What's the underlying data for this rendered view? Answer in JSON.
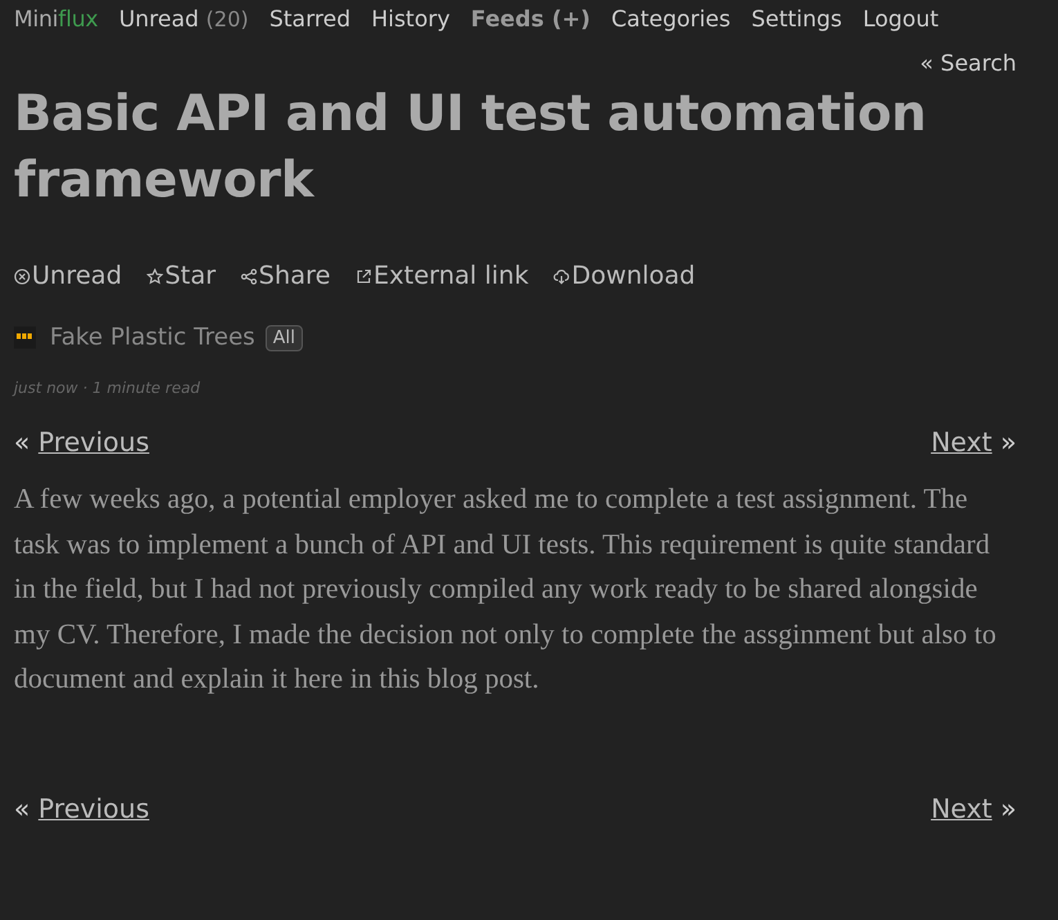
{
  "logo": {
    "prefix": "Mini",
    "suffix": "flux"
  },
  "nav": [
    {
      "label": "Unread",
      "count": "(20)",
      "selected": false
    },
    {
      "label": "Starred",
      "selected": false
    },
    {
      "label": "History",
      "selected": false
    },
    {
      "label": "Feeds (+)",
      "selected": true
    },
    {
      "label": "Categories",
      "selected": false
    },
    {
      "label": "Settings",
      "selected": false
    },
    {
      "label": "Logout",
      "selected": false
    }
  ],
  "search_link": "« Search",
  "title": "Basic API and UI test automation framework",
  "actions": [
    {
      "kind": "unread",
      "label": "Unread"
    },
    {
      "kind": "star",
      "label": "Star"
    },
    {
      "kind": "share",
      "label": "Share"
    },
    {
      "kind": "external",
      "label": "External link"
    },
    {
      "kind": "download",
      "label": "Download"
    }
  ],
  "feed": {
    "name": "Fake Plastic Trees",
    "category": "All"
  },
  "meta": "just now · 1 minute read",
  "pagination_top": {
    "prev_mark": "«",
    "prev": "Previous",
    "next": "Next",
    "next_mark": "»"
  },
  "content": "A few weeks ago, a potential employer asked me to complete a test assignment. The task was to implement a bunch of API and UI tests. This requirement is quite standard in the field, but I had not previously compiled any work ready to be shared alongside my CV. Therefore, I made the decision not only to complete the assginment but also to document and explain it here in this blog post.",
  "pagination_bottom": {
    "prev_mark": "«",
    "prev": "Previous",
    "next": "Next",
    "next_mark": "»"
  }
}
